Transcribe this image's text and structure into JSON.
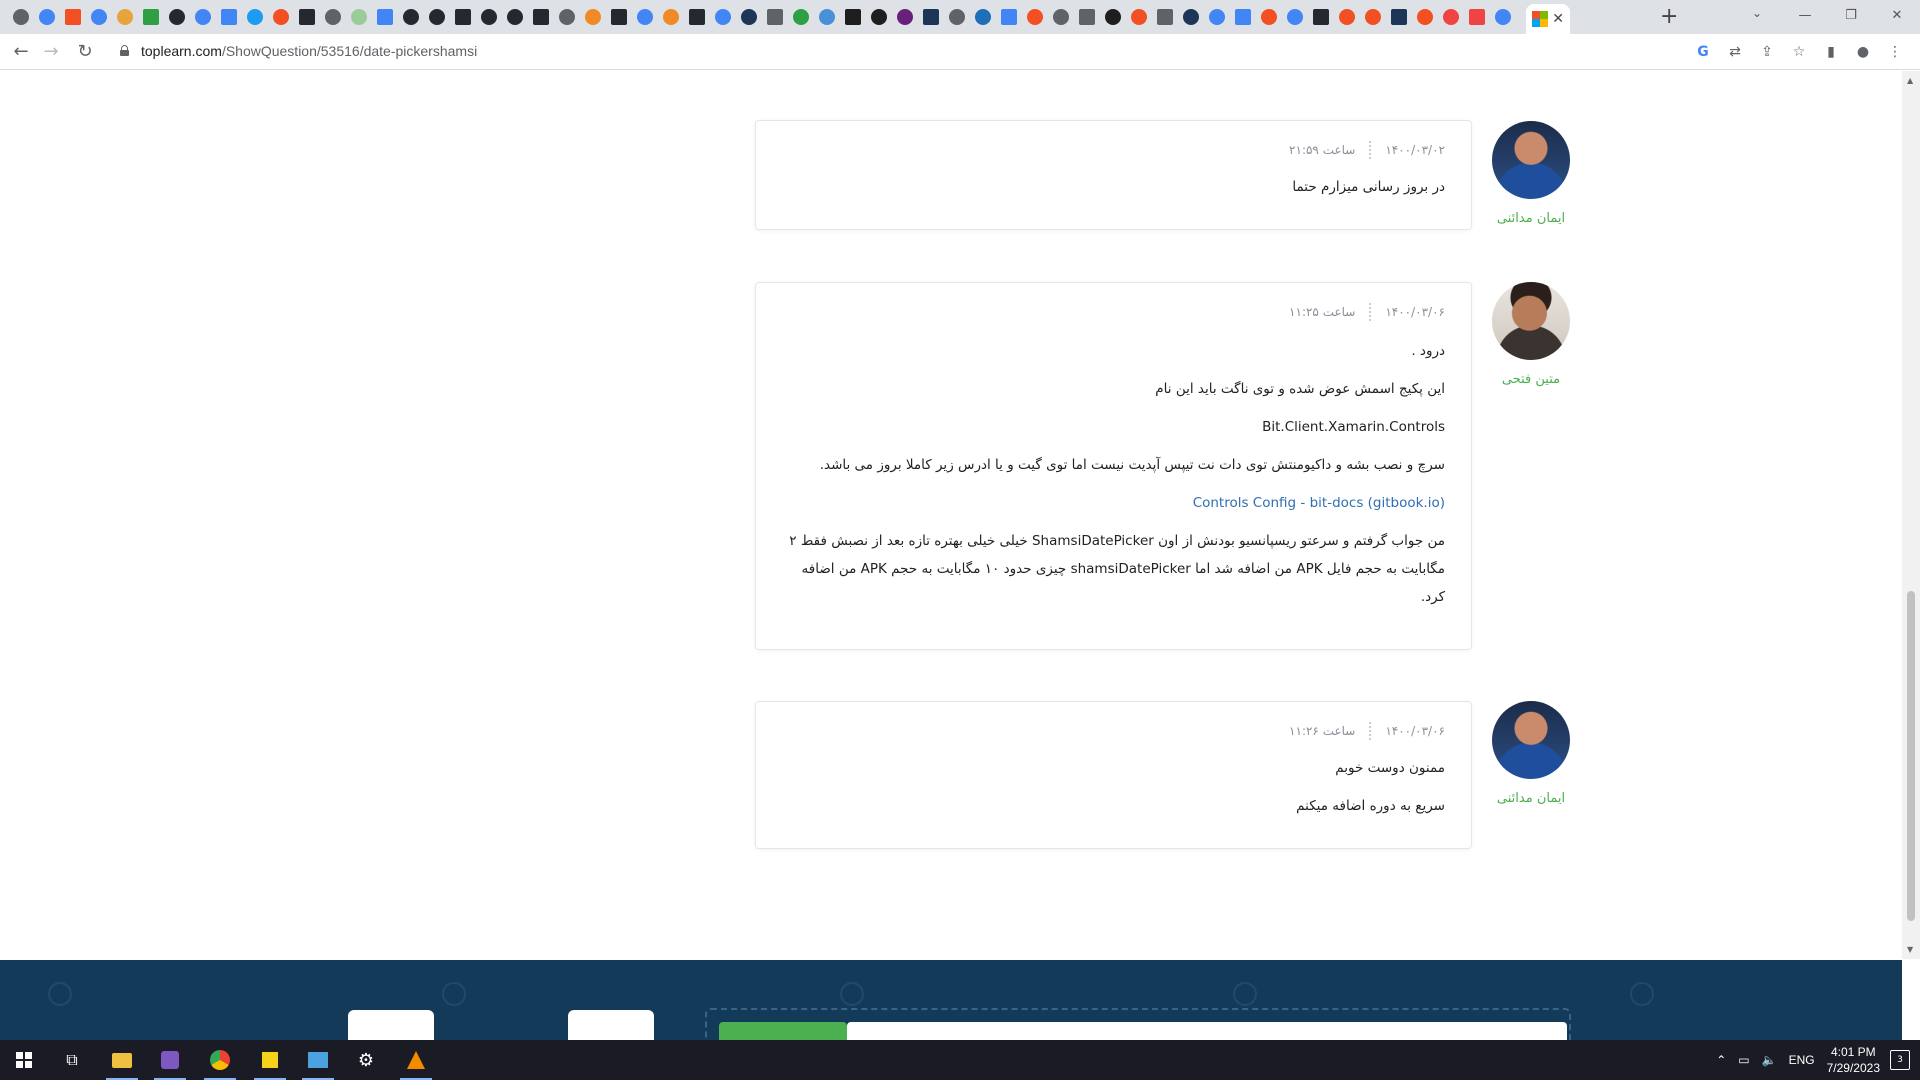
{
  "browser": {
    "url_domain": "toplearn.com",
    "url_path": "/ShowQuestion/53516/date-pickershamsi",
    "tab_favicon_colors": [
      "#5f6368",
      "#4285f4",
      "#f25022",
      "#4285f4",
      "#e8a33c",
      "#2ea043",
      "#24292f",
      "#4285f4",
      "#4285f4",
      "#1d9bf0",
      "#f25022",
      "#24292f",
      "#5f6368",
      "#9c9",
      "#4285f4",
      "#24292f",
      "#24292f",
      "#24292f",
      "#24292f",
      "#24292f",
      "#24292f",
      "#5f6368",
      "#f08a24",
      "#24292f",
      "#4285f4",
      "#f08a24",
      "#24292f",
      "#4285f4",
      "#1d3557",
      "#5f6368",
      "#2ea043",
      "#4a90d9",
      "#1e1e1e",
      "#1e1e1e",
      "#68217a",
      "#1d3557",
      "#5f6368",
      "#1d6fb8",
      "#4285f4",
      "#f25022",
      "#5f6368",
      "#5f6368",
      "#1e1e1e",
      "#f25022",
      "#5f6368",
      "#1d3557",
      "#4285f4",
      "#4285f4",
      "#f25022",
      "#4285f4",
      "#24292f",
      "#f25022",
      "#f25022",
      "#1d3557",
      "#f25022",
      "#e44",
      "#e44",
      "#4285f4"
    ]
  },
  "comments": [
    {
      "author": "ایمان مدائنی",
      "date": "۱۴۰۰/۰۳/۰۲",
      "time": "ساعت ۲۱:۵۹",
      "lines": [
        "در بروز رسانی میزارم حتما"
      ]
    },
    {
      "author": "متین فتحی",
      "date": "۱۴۰۰/۰۳/۰۶",
      "time": "ساعت ۱۱:۲۵",
      "lines": [
        "درود .",
        "این پکیج اسمش عوض شده و توی ناگت باید این نام",
        "Bit.Client.Xamarin.Controls",
        "سرچ و نصب بشه و داکیومنتش توی دات نت تیپس آپدیت نیست اما توی گیت و یا ادرس زیر کاملا بروز می باشد.",
        "Controls Config - bit-docs (gitbook.io)",
        "من جواب گرفتم و سرعتو ریسپانسیو بودنش از اون ShamsiDatePicker  خیلی خیلی بهتره تازه بعد از نصبش فقط ۲ مگابایت به حجم فایل APK من اضافه شد اما shamsiDatePicker چیزی حدود ۱۰ مگابایت به حجم APK  من اضافه کرد."
      ]
    },
    {
      "author": "ایمان مدائنی",
      "date": "۱۴۰۰/۰۳/۰۶",
      "time": "ساعت ۱۱:۲۶",
      "lines": [
        "ممنون دوست خوبم",
        "سریع به دوره اضافه میکنم"
      ]
    }
  ],
  "taskbar": {
    "language": "ENG",
    "time": "4:01 PM",
    "date": "7/29/2023",
    "notification_count": "3"
  }
}
